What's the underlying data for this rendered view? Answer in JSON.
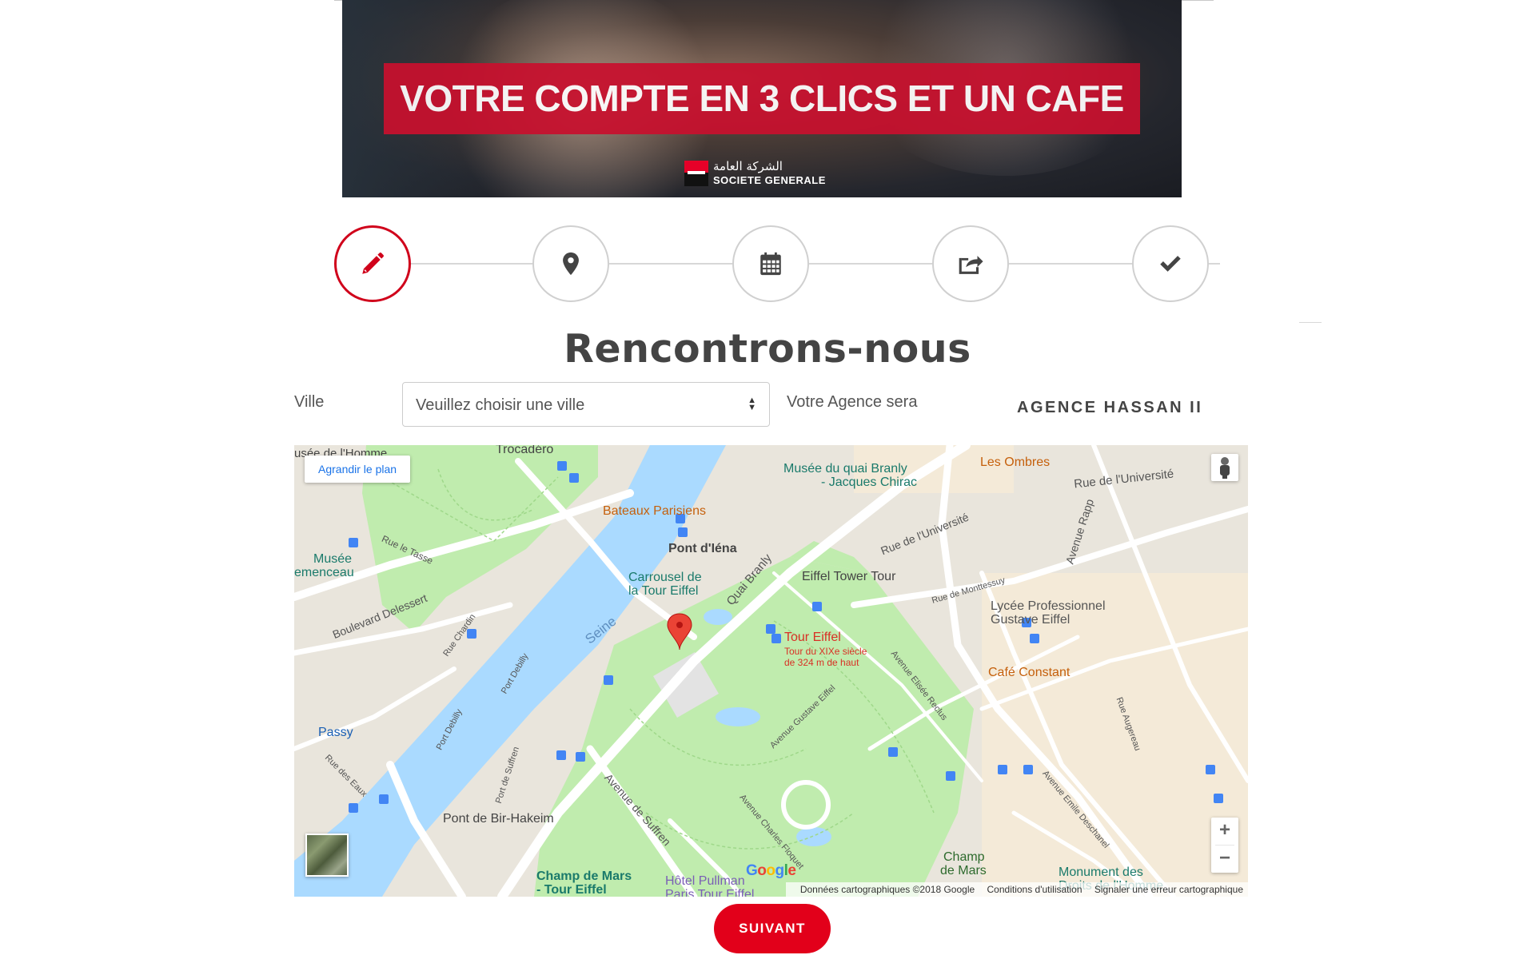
{
  "banner": {
    "title": "VOTRE COMPTE EN 3 CLICS ET UN CAFE",
    "brand_arabic": "الشركة العامة",
    "brand_name": "SOCIETE GENERALE",
    "accent_color": "#c8102e"
  },
  "steps": [
    {
      "icon": "pencil-icon",
      "active": true
    },
    {
      "icon": "map-marker-icon",
      "active": false
    },
    {
      "icon": "calendar-icon",
      "active": false
    },
    {
      "icon": "share-icon",
      "active": false
    },
    {
      "icon": "check-icon",
      "active": false
    }
  ],
  "page_title": "Rencontrons-nous",
  "form": {
    "ville_label": "Ville",
    "ville_selected": "Veuillez choisir une ville",
    "agence_label": "Votre Agence sera",
    "agence_value": "AGENCE HASSAN II"
  },
  "map": {
    "expand_label": "Agrandir le plan",
    "marker_title": "Tour Eiffel",
    "marker_sub1": "Tour du XIXe siècle",
    "marker_sub2": "de 324 m de haut",
    "labels": {
      "trocadero": "Trocadéro",
      "musee_homme": "usée de l'Homme",
      "musee_branly1": "Musée du quai Branly",
      "musee_branly2": "- Jacques Chirac",
      "les_ombres": "Les Ombres",
      "rue_universite1": "Rue de l'Université",
      "rue_universite2": "Rue de l'Université",
      "bateaux": "Bateaux Parisiens",
      "pont_iena": "Pont d'Iéna",
      "rue_tasse": "Rue le Tasse",
      "musee_clem1": "Musée",
      "musee_clem2": "emenceau",
      "carrousel1": "Carrousel de",
      "carrousel2": "la Tour Eiffel",
      "quai_branly": "Quai Branly",
      "eiffel_tour_tour": "Eiffel Tower Tour",
      "rue_monttessuy": "Rue de Monttessuy",
      "avenue_rapp": "Avenue Rapp",
      "lycee1": "Lycée Professionnel",
      "lycee2": "Gustave Eiffel",
      "boulevard_delessert": "Boulevard Delessert",
      "rue_chardin": "Rue Chardin",
      "seine": "Seine",
      "port_debilly1": "Port Debilly",
      "port_debilly2": "Port Debilly",
      "avenue_elisee": "Avenue Elisée Reclus",
      "cafe_constant": "Café Constant",
      "passy": "Passy",
      "rue_eaux": "Rue des Eaux",
      "port_suffren": "Port de Suffren",
      "avenue_gustave": "Avenue Gustave Eiffel",
      "rue_augereau": "Rue Augereau",
      "avenue_suffren": "Avenue de Suffren",
      "avenue_floquet": "Avenue Charles Floquet",
      "avenue_deschanel": "Avenue Emile Deschanel",
      "pont_bir_hakeim": "Pont de Bir-Hakeim",
      "champ_mars_tour1": "Champ de Mars",
      "champ_mars_tour2": "- Tour Eiffel",
      "hotel_pullman1": "Hôtel Pullman",
      "hotel_pullman2": "Paris Tour Eiffel",
      "champ_mars1": "Champ",
      "champ_mars2": "de Mars",
      "monument1": "Monument des",
      "monument2": "Droits de l'Homme"
    },
    "google_logo": "Google",
    "attribution": {
      "data": "Données cartographiques ©2018 Google",
      "terms": "Conditions d'utilisation",
      "report": "Signaler une erreur cartographique"
    },
    "zoom_in": "+",
    "zoom_out": "−",
    "colors": {
      "water": "#aadaff",
      "park": "#c0ecae",
      "land": "#e9e5dc",
      "road": "#ffffff",
      "marker": "#ea4335"
    }
  },
  "next_button": "SUIVANT"
}
